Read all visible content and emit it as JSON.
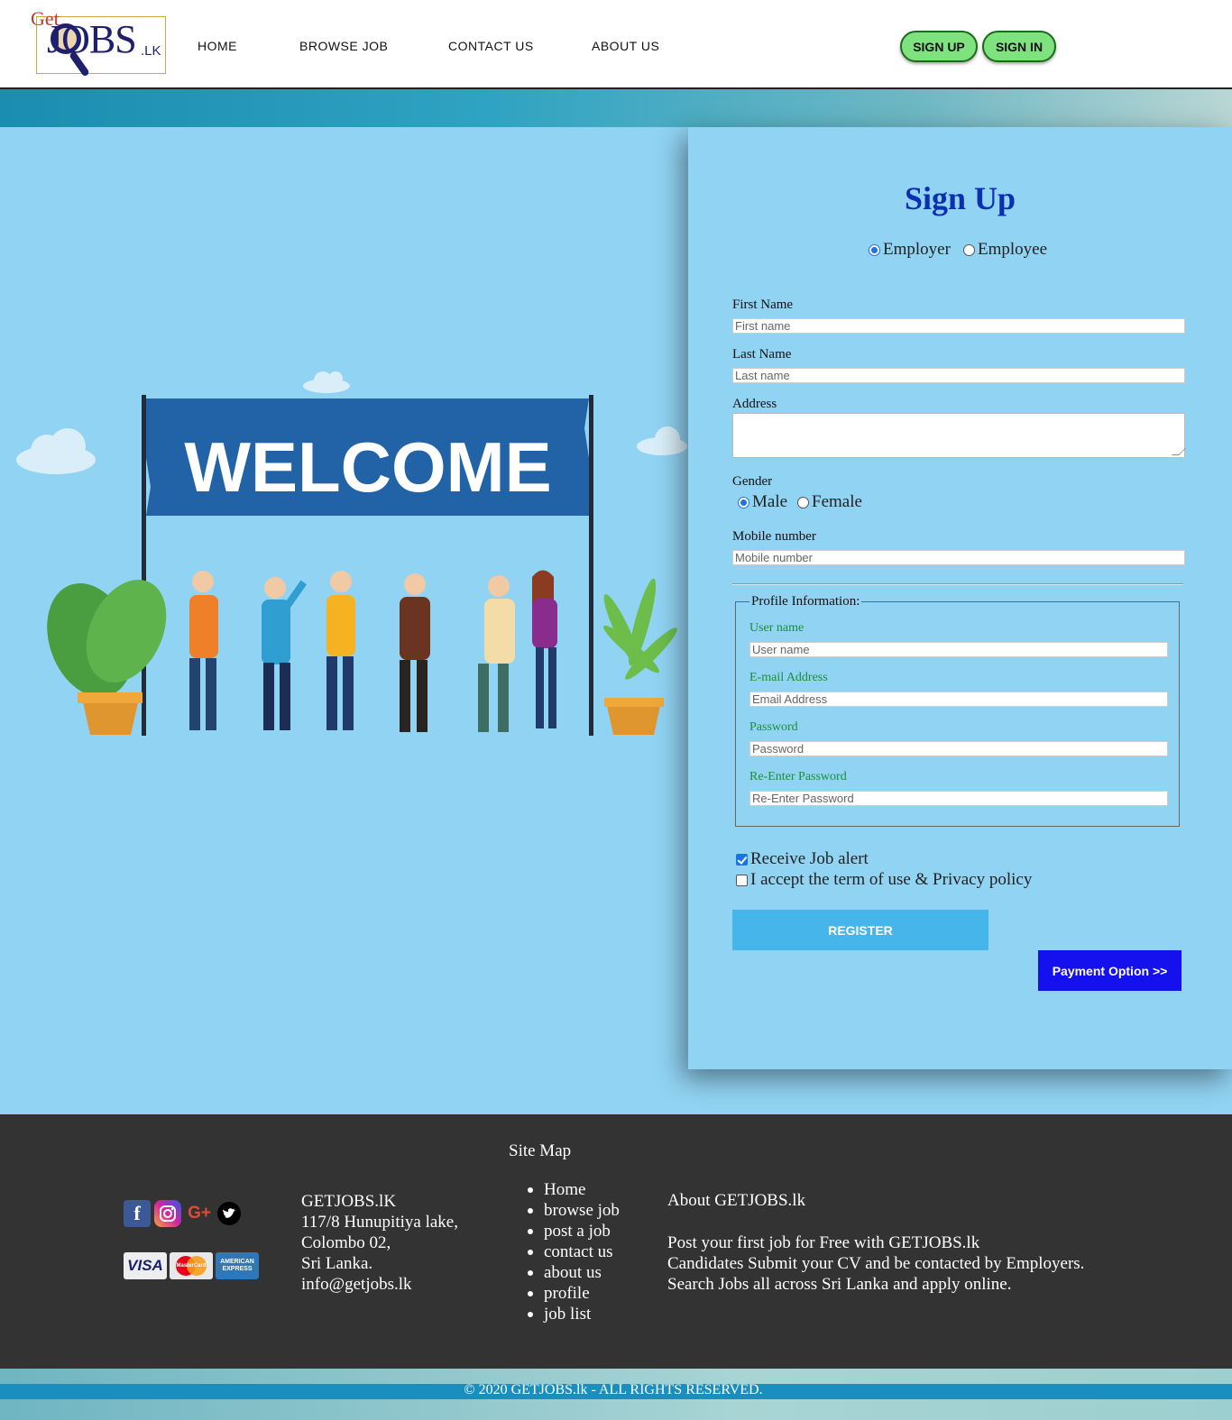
{
  "header": {
    "logo": {
      "get": "Get",
      "jobs": "JOBS",
      "lk": ".LK"
    },
    "nav": [
      "HOME",
      "BROWSE JOB",
      "CONTACT US",
      "ABOUT US"
    ],
    "signup_btn": "SIGN UP",
    "signin_btn": "SIGN IN",
    "accent_button_color": "#7ee37e"
  },
  "illustration": {
    "banner_text": "WELCOME"
  },
  "form": {
    "title": "Sign Up",
    "role_options": [
      "Employer",
      "Employee"
    ],
    "role_selected": "Employer",
    "first_name": {
      "label": "First Name",
      "placeholder": "First name"
    },
    "last_name": {
      "label": "Last Name",
      "placeholder": "Last name"
    },
    "address": {
      "label": "Address"
    },
    "gender": {
      "label": "Gender",
      "options": [
        "Male",
        "Female"
      ],
      "selected": "Male"
    },
    "mobile": {
      "label": "Mobile number",
      "placeholder": "Mobile number"
    },
    "profile": {
      "legend": "Profile Information:",
      "username": {
        "label": "User name",
        "placeholder": "User name"
      },
      "email": {
        "label": "E-mail Address",
        "placeholder": "Email Address"
      },
      "password": {
        "label": "Password",
        "placeholder": "Password"
      },
      "repassword": {
        "label": "Re-Enter Password",
        "placeholder": "Re-Enter Password"
      }
    },
    "job_alert": {
      "label": "Receive Job alert",
      "checked": true
    },
    "terms": {
      "label": "I accept the term of use & Privacy policy",
      "checked": false
    },
    "register": "REGISTER",
    "payment": "Payment Option >>",
    "title_color": "#0b2fb0",
    "payment_color": "#1411ee"
  },
  "footer": {
    "sitemap_title": "Site Map",
    "address": [
      "GETJOBS.lK",
      "117/8 Hunupitiya lake,",
      "Colombo 02,",
      "Sri Lanka.",
      "info@getjobs.lk"
    ],
    "sitemap": [
      "Home",
      "browse job",
      "post a job",
      "contact us",
      "about us",
      "profile",
      "job list"
    ],
    "about_title": "About GETJOBS.lk",
    "about_lines": [
      "Post your first job for Free with GETJOBS.lk",
      "Candidates Submit your CV and be contacted by Employers.",
      "Search Jobs all across Sri Lanka and apply online."
    ],
    "social": [
      "facebook-icon",
      "instagram-icon",
      "google-plus-icon",
      "twitter-icon"
    ],
    "social_glyphs": {
      "facebook": "f",
      "googleplus": "G+"
    },
    "cards": {
      "visa": "VISA",
      "mastercard": "MasterCard",
      "amex": "AMERICAN EXPRESS"
    },
    "copyright": "© 2020 GETJOBS.lk - ALL RIGHTS RESERVED."
  }
}
